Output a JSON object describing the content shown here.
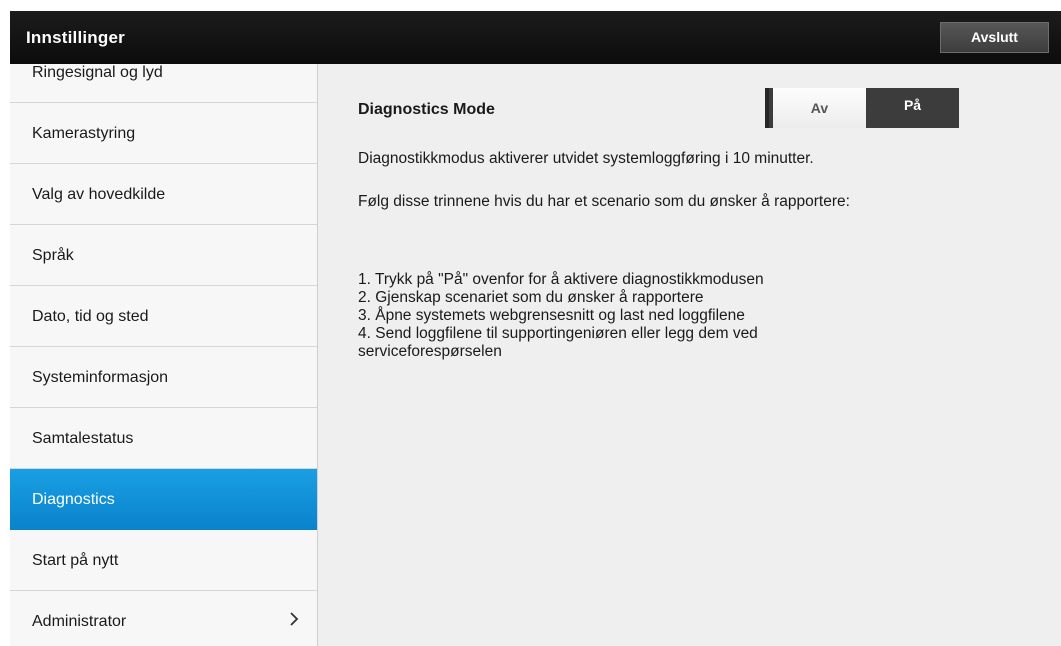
{
  "header": {
    "title": "Innstillinger",
    "exit_label": "Avslutt"
  },
  "sidebar": {
    "items": [
      {
        "label": "Ringesignal og lyd"
      },
      {
        "label": "Kamerastyring"
      },
      {
        "label": "Valg av hovedkilde"
      },
      {
        "label": "Språk"
      },
      {
        "label": "Dato, tid og sted"
      },
      {
        "label": "Systeminformasjon"
      },
      {
        "label": "Samtalestatus"
      },
      {
        "label": "Diagnostics",
        "active": true
      },
      {
        "label": "Start på nytt"
      },
      {
        "label": "Administrator",
        "has_submenu": true
      }
    ],
    "active_color": "#0a8fd6"
  },
  "main": {
    "title": "Diagnostics Mode",
    "toggle": {
      "off_label": "Av",
      "on_label": "På",
      "selected": "Av"
    },
    "description": "Diagnostikkmodus aktiverer utvidet systemloggføring i 10 minutter.",
    "instructions_intro": "Følg disse trinnene hvis du har et scenario som du ønsker å rapportere:",
    "steps": [
      "1. Trykk på \"På\" ovenfor for å aktivere diagnostikkmodusen",
      "2. Gjenskap scenariet som du ønsker å rapportere",
      "3. Åpne systemets webgrensesnitt og last ned loggfilene",
      "4. Send loggfilene til supportingeniøren eller legg dem ved serviceforespørselen"
    ]
  }
}
